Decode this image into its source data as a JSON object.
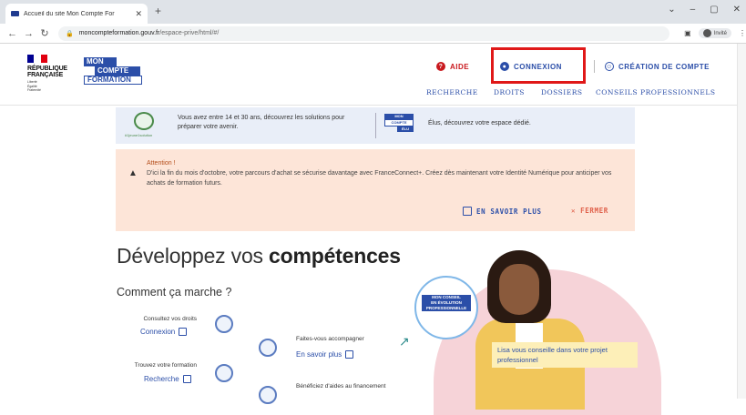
{
  "browser": {
    "tab_title": "Accueil du site Mon Compte For",
    "url_host": "moncompteformation.gouv.fr",
    "url_path": "/espace-prive/html/#/",
    "profile_label": "Invité"
  },
  "header": {
    "republique": [
      "RÉPUBLIQUE",
      "FRANÇAISE"
    ],
    "devise": [
      "Liberté",
      "Égalité",
      "Fraternité"
    ],
    "logo": [
      "MON",
      "COMPTE",
      "FORMATION"
    ],
    "aide": "AIDE",
    "connexion": "CONNEXION",
    "creation": "CRÉATION DE COMPTE",
    "nav": [
      "RECHERCHE",
      "DROITS",
      "DOSSIERS",
      "CONSEILS PROFESSIONNELS"
    ]
  },
  "banner": {
    "tag": "#1jeune1solution",
    "text1": "Vous avez entre 14 et 30 ans, découvrez les solutions pour préparer votre avenir.",
    "elus_logo": [
      "MON",
      "COMPTE",
      "ÉLU"
    ],
    "text2": "Élus, découvrez votre espace dédié."
  },
  "alert": {
    "title": "Attention !",
    "body": "D'ici la fin du mois d'octobre, votre parcours d'achat se sécurise davantage avec FranceConnect+. Créez dès maintenant votre Identité Numérique pour anticiper vos achats de formation futurs.",
    "learn_more": "EN SAVOIR PLUS",
    "close": "FERMER"
  },
  "main": {
    "title_regular": "Développez vos ",
    "title_bold": "compétences",
    "subtitle": "Comment ça marche ?",
    "steps": [
      {
        "label": "Consultez vos droits",
        "link": "Connexion"
      },
      {
        "label": "Faites-vous accompagner",
        "link": "En savoir plus"
      },
      {
        "label": "Trouvez votre formation",
        "link": "Recherche"
      },
      {
        "label": "Bénéficiez d'aides au financement",
        "link": ""
      }
    ],
    "ring_badge": [
      "MON CONSEIL",
      "EN ÉVOLUTION",
      "PROFESSIONNELLE"
    ],
    "caption": "Lisa vous conseille dans votre projet professionnel"
  },
  "colors": {
    "primary": "#2b4ea8",
    "danger": "#c9191e",
    "alert_bg": "#fde5d8",
    "banner_bg": "#e9eef8",
    "highlight": "#e01818"
  }
}
